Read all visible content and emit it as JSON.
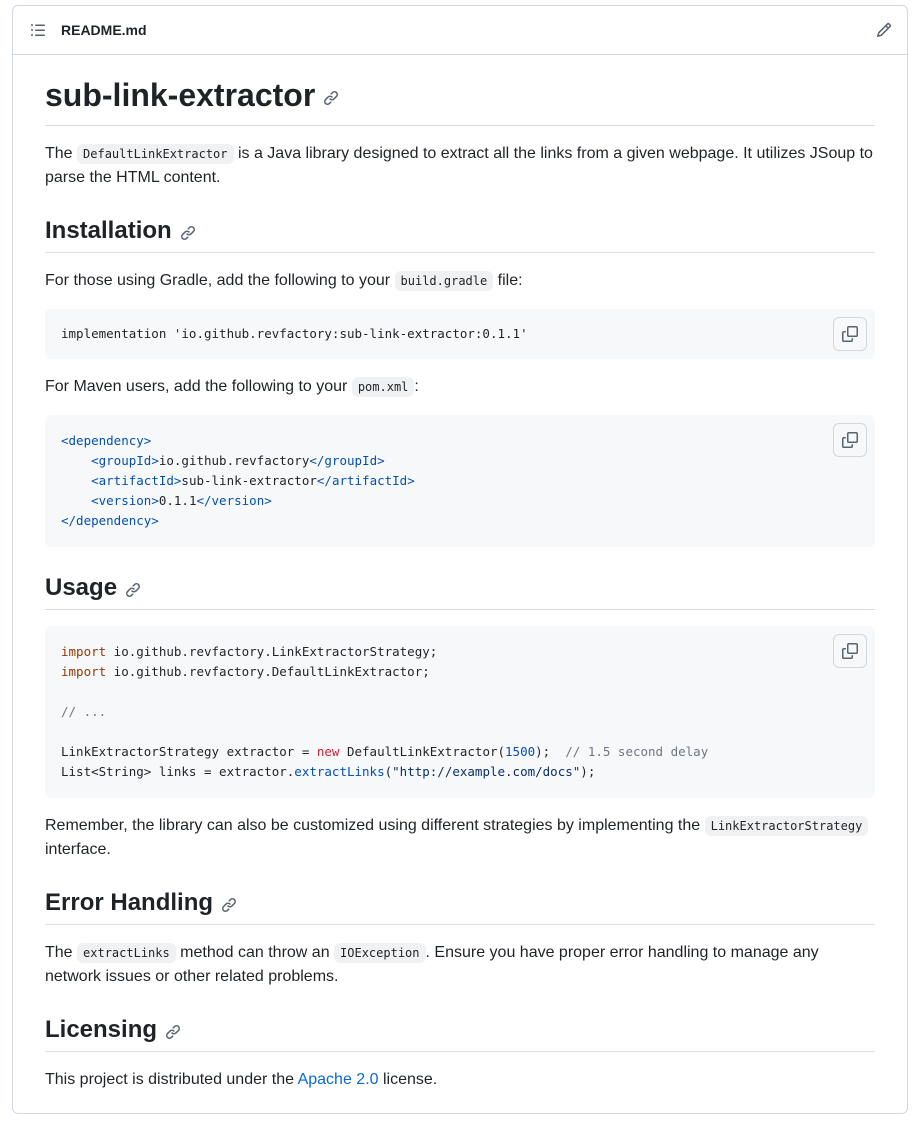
{
  "header": {
    "file_name": "README.md",
    "outline_icon": "list-unordered-icon",
    "edit_icon": "pencil-icon"
  },
  "title": "sub-link-extractor",
  "intro": {
    "pre": "The ",
    "code": "DefaultLinkExtractor",
    "post": " is a Java library designed to extract all the links from a given webpage. It utilizes JSoup to parse the HTML content."
  },
  "installation": {
    "heading": "Installation",
    "gradle_pre": "For those using Gradle, add the following to your ",
    "gradle_code": "build.gradle",
    "gradle_post": " file:",
    "gradle_line": "implementation 'io.github.revfactory:sub-link-extractor:0.1.1'",
    "maven_pre": "For Maven users, add the following to your ",
    "maven_code": "pom.xml",
    "maven_post": ":",
    "maven": {
      "dep_open": "<dependency>",
      "group_open": "<groupId>",
      "group_val": "io.github.revfactory",
      "group_close": "</groupId>",
      "artifact_open": "<artifactId>",
      "artifact_val": "sub-link-extractor",
      "artifact_close": "</artifactId>",
      "version_open": "<version>",
      "version_val": "0.1.1",
      "version_close": "</version>",
      "dep_close": "</dependency>"
    }
  },
  "usage": {
    "heading": "Usage",
    "import_kw": "import",
    "import1": " io.github.revfactory.LinkExtractorStrategy;",
    "import2": " io.github.revfactory.DefaultLinkExtractor;",
    "comment1": "// ...",
    "l5_a": "LinkExtractorStrategy extractor = ",
    "l5_new": "new",
    "l5_b": " DefaultLinkExtractor(",
    "l5_num": "1500",
    "l5_c": ");  ",
    "l5_comment": "// 1.5 second delay",
    "l6_a": "List<String> links = extractor.",
    "l6_fn": "extractLinks",
    "l6_b": "(",
    "l6_str": "\"http://example.com/docs\"",
    "l6_c": ");",
    "after_pre": "Remember, the library can also be customized using different strategies by implementing the ",
    "after_code": "LinkExtractorStrategy",
    "after_post": " interface."
  },
  "errors": {
    "heading": "Error Handling",
    "pre": "The ",
    "code1": "extractLinks",
    "mid": " method can throw an ",
    "code2": "IOException",
    "post": ". Ensure you have proper error handling to manage any network issues or other related problems."
  },
  "licensing": {
    "heading": "Licensing",
    "pre": "This project is distributed under the ",
    "link": "Apache 2.0",
    "post": " license."
  },
  "colors": {
    "link": "#0969da",
    "border": "#d0d7de",
    "code_bg": "#f6f8fa"
  }
}
